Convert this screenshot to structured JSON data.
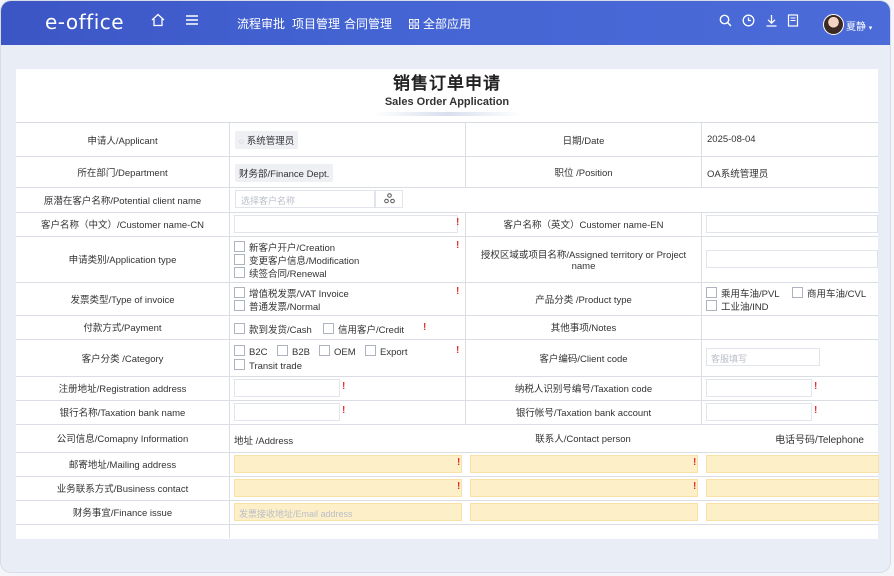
{
  "header": {
    "logo": "e-office",
    "nav": [
      "流程审批",
      "项目管理",
      "合同管理",
      "全部应用"
    ],
    "user": "夏静"
  },
  "form": {
    "title_cn": "销售订单申请",
    "title_en": "Sales Order Application",
    "applicant_label": "申请人/Applicant",
    "applicant_value": "系统管理员",
    "date_label": "日期/Date",
    "date_value": "2025-08-04",
    "dept_label": "所在部门/Department",
    "dept_value": "财务部/Finance Dept.",
    "position_label": "职位 /Position",
    "position_value": "OA系统管理员",
    "potential_label": "原潜在客户名称/Potential client name",
    "potential_placeholder": "选择客户名称",
    "customer_cn_label": "客户名称（中文）/Customer name-CN",
    "customer_en_label": "客户名称（英文）Customer name-EN",
    "app_type_label": "申请类别/Application type",
    "app_type_options": [
      "新客户开户/Creation",
      "变更客户信息/Modification",
      "续签合同/Renewal"
    ],
    "territory_label": "授权区域或项目名称/Assigned territory or Project name",
    "invoice_label": "发票类型/Type of invoice",
    "invoice_options": [
      "增值税发票/VAT Invoice",
      "普通发票/Normal"
    ],
    "product_label": "产品分类 /Product type",
    "product_options": [
      "乘用车油/PVL",
      "商用车油/CVL",
      "工业油/IND"
    ],
    "payment_label": "付款方式/Payment",
    "payment_options": [
      "款到发货/Cash",
      "信用客户/Credit"
    ],
    "notes_label": "其他事项/Notes",
    "category_label": "客户分类 /Category",
    "category_options": [
      "B2C",
      "B2B",
      "OEM",
      "Export",
      "Transit trade"
    ],
    "client_code_label": "客户编码/Client code",
    "client_code_placeholder": "客服填写",
    "reg_addr_label": "注册地址/Registration address",
    "tax_code_label": "纳税人识别号编号/Taxation code",
    "bank_name_label": "银行名称/Taxation bank name",
    "bank_acc_label": "银行帐号/Taxation bank account",
    "company_info_label": "公司信息/Comapny Information",
    "address_label": "地址 /Address",
    "contact_label": "联系人/Contact person",
    "telephone_label": "电话号码/Telephone",
    "mailing_label": "邮寄地址/Mailing address",
    "business_label": "业务联系方式/Business contact",
    "finance_label": "财务事宜/Finance issue",
    "finance_placeholder": "发票接收地址/Email address",
    "required_mark": "!"
  },
  "icons": [
    "home-icon",
    "menu-icon",
    "grid-icon",
    "search-icon",
    "clock-icon",
    "download-icon",
    "doc-icon",
    "org-icon",
    "user-icon"
  ]
}
